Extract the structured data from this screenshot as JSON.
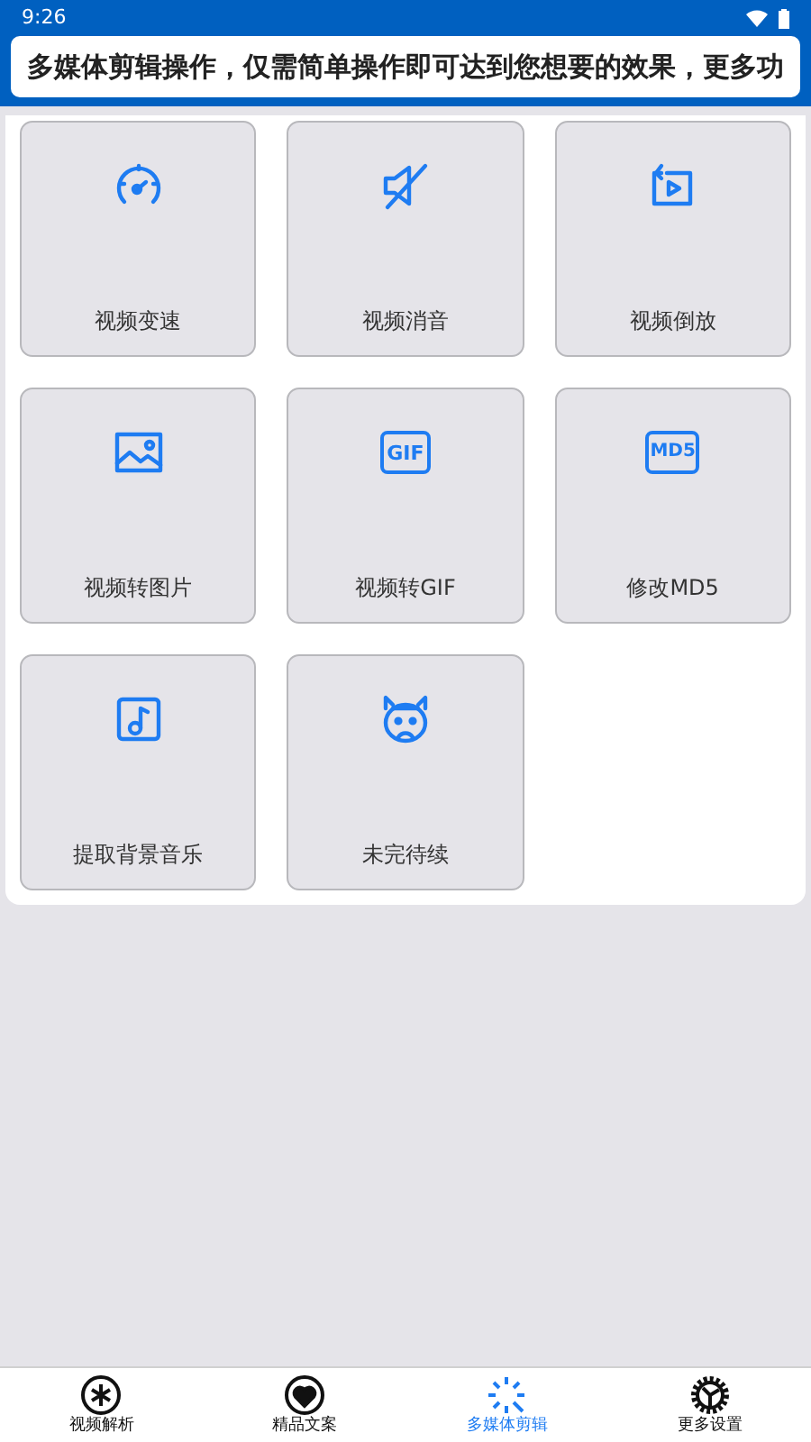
{
  "status_bar": {
    "time": "9:26"
  },
  "marquee": {
    "text": "多媒体剪辑操作，仅需简单操作即可达到您想要的效果，更多功"
  },
  "tools": [
    {
      "label": "视频变速"
    },
    {
      "label": "视频消音"
    },
    {
      "label": "视频倒放"
    },
    {
      "label": "视频转图片"
    },
    {
      "label": "视频转GIF",
      "icon_text": "GIF"
    },
    {
      "label": "修改MD5",
      "icon_text": "MD5"
    },
    {
      "label": "提取背景音乐"
    },
    {
      "label": "未完待续"
    }
  ],
  "nav": [
    {
      "label": "视频解析",
      "selected": false
    },
    {
      "label": "精品文案",
      "selected": false
    },
    {
      "label": "多媒体剪辑",
      "selected": true
    },
    {
      "label": "更多设置",
      "selected": false
    }
  ]
}
